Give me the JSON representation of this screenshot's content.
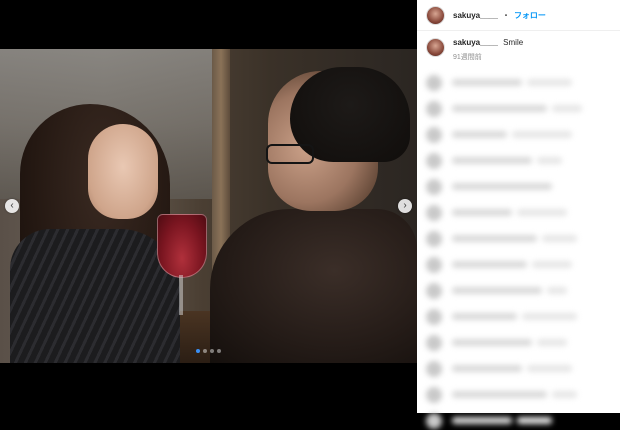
{
  "post": {
    "username": "sakuya____",
    "separator": "・",
    "follow_label": "フォロー",
    "caption_text": "Smile",
    "timestamp": "91週間前"
  },
  "carousel": {
    "prev_glyph": "‹",
    "next_glyph": "›",
    "total_slides": 4,
    "active_slide": 1
  },
  "icons": [
    "chevron-left-icon",
    "chevron-right-icon",
    "avatar"
  ],
  "colors": {
    "follow": "#0095f6",
    "active_dot": "#3a8ff5",
    "text": "#262626",
    "muted": "#8e8e8e"
  }
}
